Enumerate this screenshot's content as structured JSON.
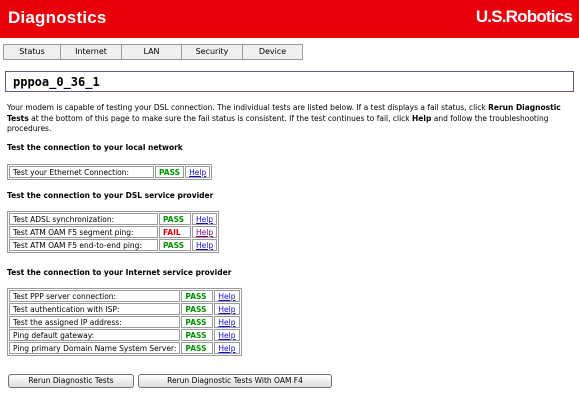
{
  "header": {
    "title": "Diagnostics",
    "logo": "U.S.Robotics",
    "bg_color": "#e8000b"
  },
  "tabs": [
    {
      "label": "Status"
    },
    {
      "label": "Internet"
    },
    {
      "label": "LAN"
    },
    {
      "label": "Security"
    },
    {
      "label": "Device"
    }
  ],
  "connection_name": "pppoa_0_36_1",
  "intro": {
    "part1": "Your modem is capable of testing your DSL connection. The individual tests are listed below. If a test displays a fail status, click ",
    "bold1": "Rerun Diagnostic Tests",
    "part2": " at the bottom of this page to make sure the fail status is consistent. If the test continues to fail, click ",
    "bold2": "Help",
    "part3": " and follow the troubleshooting procedures."
  },
  "sections": [
    {
      "heading": "Test the connection to your local network",
      "tests": [
        {
          "name": "Test your Ethernet Connection:",
          "result": "PASS",
          "help": "Help"
        }
      ]
    },
    {
      "heading": "Test the connection to your DSL service provider",
      "tests": [
        {
          "name": "Test ADSL synchronization:",
          "result": "PASS",
          "help": "Help"
        },
        {
          "name": "Test ATM OAM F5 segment ping:",
          "result": "FAIL",
          "help": "Help"
        },
        {
          "name": "Test ATM OAM F5 end-to-end ping:",
          "result": "PASS",
          "help": "Help"
        }
      ]
    },
    {
      "heading": "Test the connection to your Internet service provider",
      "tests": [
        {
          "name": "Test PPP server connection:",
          "result": "PASS",
          "help": "Help"
        },
        {
          "name": "Test authentication with ISP:",
          "result": "PASS",
          "help": "Help"
        },
        {
          "name": "Test the assigned IP address:",
          "result": "PASS",
          "help": "Help"
        },
        {
          "name": "Ping default gateway:",
          "result": "PASS",
          "help": "Help"
        },
        {
          "name": "Ping primary Domain Name System Server:",
          "result": "PASS",
          "help": "Help"
        }
      ]
    }
  ],
  "buttons": {
    "rerun": "Rerun Diagnostic Tests",
    "rerun_oam": "Rerun Diagnostic Tests With OAM F4"
  },
  "colors": {
    "pass": "#009000",
    "fail": "#e00000",
    "link": "#1010cc",
    "visited_link": "#800080"
  }
}
